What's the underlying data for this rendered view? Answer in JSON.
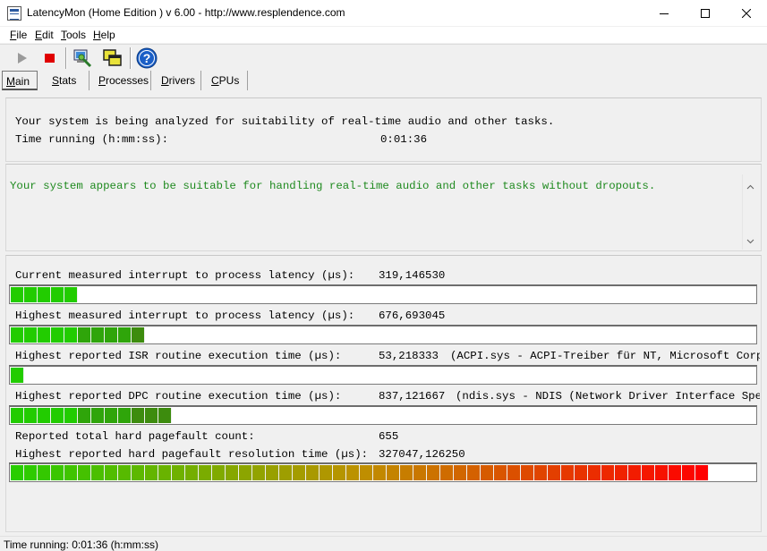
{
  "window": {
    "title": "LatencyMon  (Home Edition )  v 6.00 - http://www.resplendence.com"
  },
  "menu": [
    {
      "acc": "F",
      "rest": "ile"
    },
    {
      "acc": "E",
      "rest": "dit"
    },
    {
      "acc": "T",
      "rest": "ools"
    },
    {
      "acc": "H",
      "rest": "elp"
    }
  ],
  "toolbar": {
    "icons": [
      "play-icon",
      "stop-icon",
      "analyze-icon",
      "windows-icon",
      "help-icon"
    ],
    "colors": {
      "stop": "#e00000",
      "help": "#1a5fc7"
    }
  },
  "tabs": [
    {
      "acc": "M",
      "rest": "ain"
    },
    {
      "acc": "S",
      "rest": "tats"
    },
    {
      "acc": "P",
      "rest": "rocesses"
    },
    {
      "acc": "D",
      "rest": "rivers"
    },
    {
      "acc": "C",
      "rest": "PUs"
    }
  ],
  "status": {
    "analyzing": "Your system is being analyzed for suitability of real-time audio and other tasks.",
    "time_label": "Time running (h:mm:ss):",
    "time_value": "0:01:36",
    "verdict": "Your system appears to be suitable for handling real-time audio and other tasks without dropouts.",
    "verdict_color": "#1f8a1f"
  },
  "metrics": {
    "current_latency": {
      "label": "Current measured interrupt to process latency (µs):",
      "value": "319,146530",
      "detail": "",
      "segments": 5
    },
    "highest_latency": {
      "label": "Highest measured interrupt to process latency (µs):",
      "value": "676,693045",
      "detail": "",
      "segments": 10
    },
    "highest_isr": {
      "label": "Highest reported ISR routine execution time (µs):",
      "value": "53,218333",
      "detail": "(ACPI.sys - ACPI-Treiber für NT, Microsoft Corpora",
      "segments": 1
    },
    "highest_dpc": {
      "label": "Highest reported DPC routine execution time (µs):",
      "value": "837,121667",
      "detail": "(ndis.sys - NDIS (Network Driver Interface Specif",
      "segments": 12
    },
    "pagefault_count": {
      "label": "Reported total hard pagefault count:",
      "value": "655"
    },
    "pagefault_resolution": {
      "label": "Highest reported hard pagefault resolution time (µs):",
      "value": "327047,126250",
      "detail": "",
      "segments": 52
    }
  },
  "statusbar": {
    "text": "Time running: 0:01:36  (h:mm:ss)"
  }
}
